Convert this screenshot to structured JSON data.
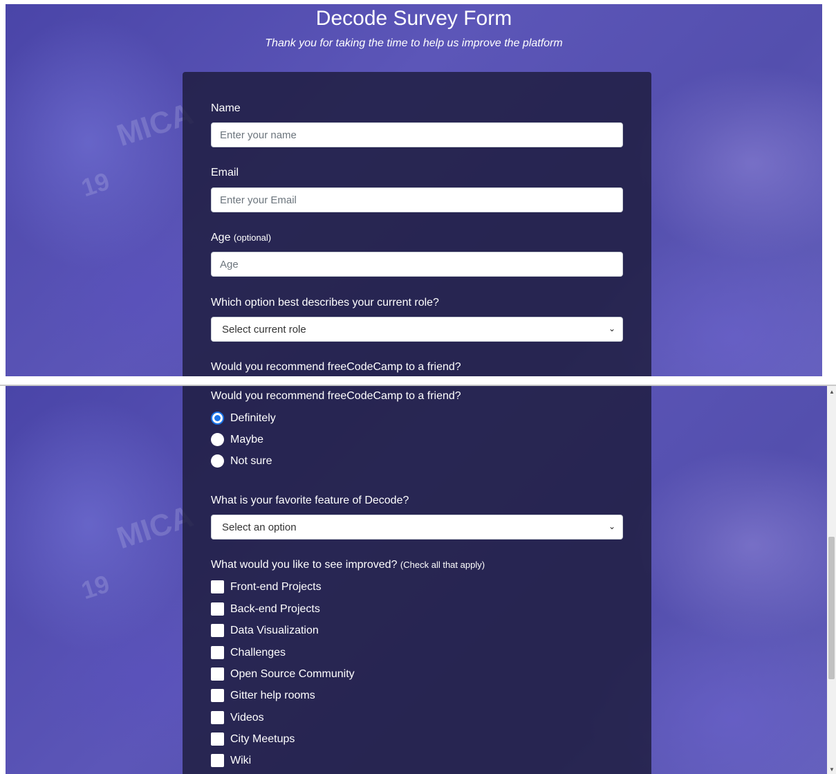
{
  "header": {
    "title": "Decode Survey Form",
    "subtitle": "Thank you for taking the time to help us improve the platform"
  },
  "form": {
    "name": {
      "label": "Name",
      "placeholder": "Enter your name"
    },
    "email": {
      "label": "Email",
      "placeholder": "Enter your Email"
    },
    "age": {
      "label": "Age",
      "note": "(optional)",
      "placeholder": "Age"
    },
    "role": {
      "label": "Which option best describes your current role?",
      "selected": "Select current role"
    },
    "recommend": {
      "label": "Would you recommend freeCodeCamp to a friend?",
      "options": [
        "Definitely",
        "Maybe",
        "Not sure"
      ],
      "selected": "Definitely"
    },
    "feature": {
      "label": "What is your favorite feature of Decode?",
      "selected": "Select an option"
    },
    "improve": {
      "label": "What would you like to see improved?",
      "note": "(Check all that apply)",
      "options": [
        "Front-end Projects",
        "Back-end Projects",
        "Data Visualization",
        "Challenges",
        "Open Source Community",
        "Gitter help rooms",
        "Videos",
        "City Meetups",
        "Wiki"
      ]
    }
  },
  "icons": {
    "dropdown": "chevron-down-icon",
    "scroll_up": "scroll-up-arrow-icon",
    "scroll_down": "scroll-down-arrow-icon"
  },
  "colors": {
    "background": "#544fae",
    "card": "#1b1a3a",
    "radio_accent": "#1a73e8",
    "text": "#ffffff"
  }
}
